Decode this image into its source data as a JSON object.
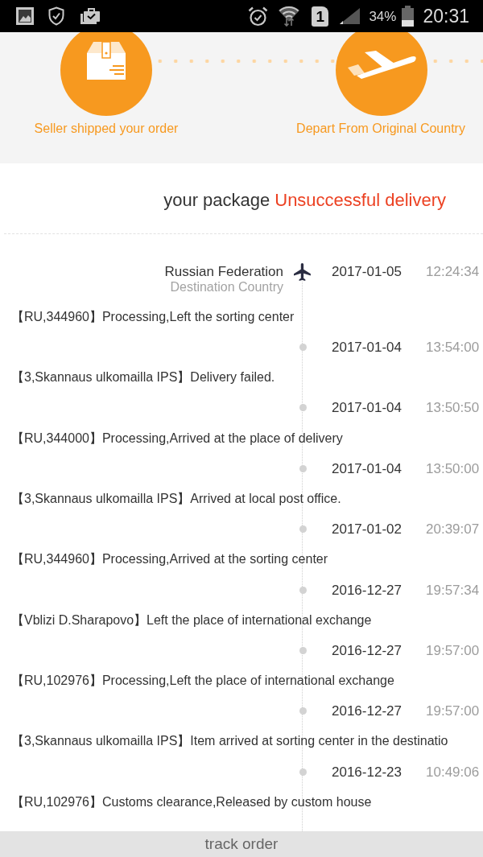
{
  "status_bar": {
    "sim": "1",
    "battery": "34%",
    "time": "20:31"
  },
  "progress_steps": [
    {
      "kind": "box",
      "label": "Seller shipped your order"
    },
    {
      "kind": "plane",
      "label": "Depart From Original Country"
    }
  ],
  "package_status": {
    "prefix": "your package",
    "status": "Unsuccessful delivery"
  },
  "events": [
    {
      "kind": "destination",
      "location": "Russian Federation",
      "location_note": "Destination Country",
      "date": "2017-01-05",
      "time": "12:24:34",
      "description": "【RU,344960】Processing,Left the sorting center"
    },
    {
      "kind": "dot",
      "date": "2017-01-04",
      "time": "13:54:00",
      "description": "【3,Skannaus ulkomailla IPS】Delivery failed."
    },
    {
      "kind": "dot",
      "date": "2017-01-04",
      "time": "13:50:50",
      "description": "【RU,344000】Processing,Arrived at the place of delivery"
    },
    {
      "kind": "dot",
      "date": "2017-01-04",
      "time": "13:50:00",
      "description": "【3,Skannaus ulkomailla IPS】Arrived at local post office."
    },
    {
      "kind": "dot",
      "date": "2017-01-02",
      "time": "20:39:07",
      "description": "【RU,344960】Processing,Arrived at the sorting center"
    },
    {
      "kind": "dot",
      "date": "2016-12-27",
      "time": "19:57:34",
      "description": "【Vblizi D.Sharapovo】Left the place of international exchange"
    },
    {
      "kind": "dot",
      "date": "2016-12-27",
      "time": "19:57:00",
      "description": "【RU,102976】Processing,Left the place of international exchange"
    },
    {
      "kind": "dot",
      "date": "2016-12-27",
      "time": "19:57:00",
      "description": "【3,Skannaus ulkomailla IPS】Item arrived at sorting center in the destinatio"
    },
    {
      "kind": "dot",
      "date": "2016-12-23",
      "time": "10:49:06",
      "description": "【RU,102976】Customs clearance,Released by custom house"
    }
  ],
  "bottom_button": {
    "label": "track order"
  }
}
